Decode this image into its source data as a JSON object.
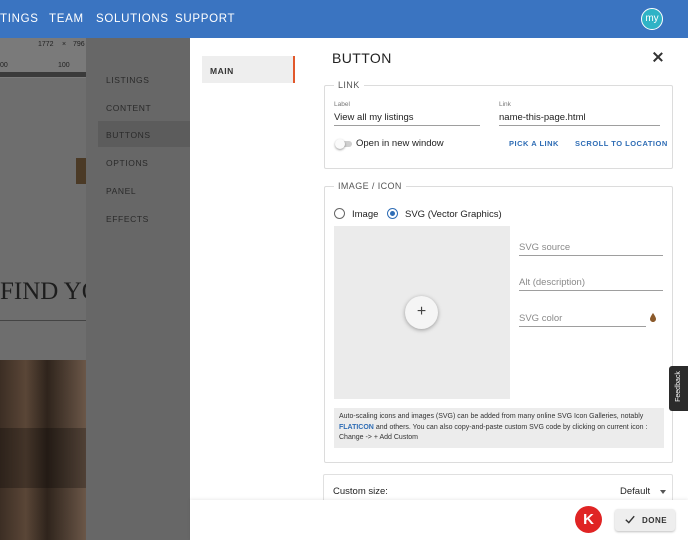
{
  "topnav": {
    "items": [
      "TINGS",
      "TEAM",
      "SOLUTIONS",
      "SUPPORT"
    ],
    "logo_text": "my",
    "brand_color": "#3a74c1"
  },
  "background_page": {
    "ruler_values": [
      "1772",
      "×",
      "796"
    ],
    "ruler_small": [
      "00",
      "100"
    ],
    "hero_text": "FIND YO"
  },
  "submenu": {
    "items": [
      "LISTINGS",
      "CONTENT",
      "BUTTONS",
      "OPTIONS",
      "PANEL",
      "EFFECTS"
    ],
    "active": "BUTTONS"
  },
  "dialog": {
    "tab": "MAIN",
    "title": "BUTTON",
    "link_section": {
      "legend": "LINK",
      "label_caption": "Label",
      "label_value": "View all my listings",
      "link_caption": "Link",
      "link_value": "name-this-page.html",
      "toggle_label": "Open in new window",
      "pick_link": "PICK A LINK",
      "scroll_to": "SCROLL TO LOCATION"
    },
    "image_section": {
      "legend": "IMAGE / ICON",
      "radio_image": "Image",
      "radio_svg": "SVG (Vector Graphics)",
      "selected": "SVG (Vector Graphics)",
      "add_symbol": "+",
      "svg_source_placeholder": "SVG source",
      "alt_placeholder": "Alt (description)",
      "svg_color_placeholder": "SVG color",
      "info_part1": "Auto-scaling icons and images (SVG) can be added from many online SVG Icon Galleries, notably ",
      "info_link": "FLATICON",
      "info_part2": " and others. You can also copy-and-paste custom SVG code by clicking on current icon : Change -> + Add Custom"
    },
    "custom_size": {
      "label": "Custom size:",
      "value": "Default"
    },
    "footer": {
      "badge": "K",
      "done": "DONE"
    }
  },
  "feedback": "Feedback",
  "colors": {
    "accent": "#2f6db5",
    "tab_indicator": "#e2582b",
    "badge": "#e02424"
  }
}
